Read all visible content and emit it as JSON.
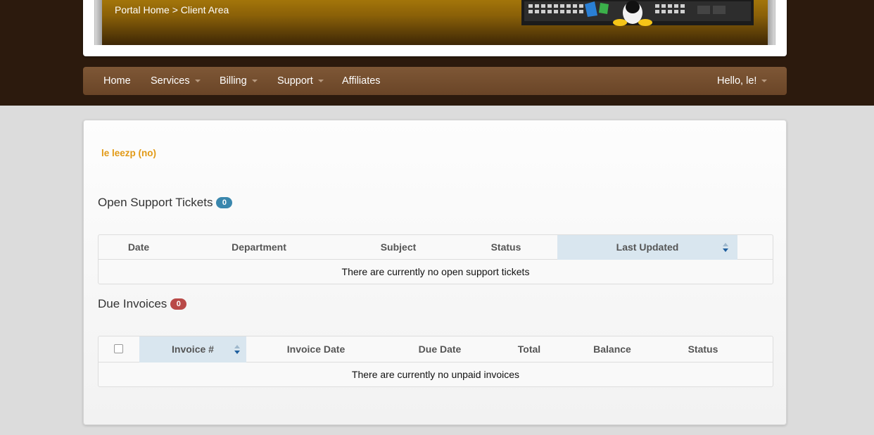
{
  "breadcrumb": {
    "home": "Portal Home",
    "separator": ">",
    "current": "Client Area"
  },
  "nav": {
    "items": [
      {
        "label": "Home",
        "dropdown": false
      },
      {
        "label": "Services",
        "dropdown": true
      },
      {
        "label": "Billing",
        "dropdown": true
      },
      {
        "label": "Support",
        "dropdown": true
      },
      {
        "label": "Affiliates",
        "dropdown": false
      }
    ],
    "user_menu": "Hello, le!"
  },
  "client": {
    "name": "le leezp (no)"
  },
  "tickets": {
    "title": "Open Support Tickets",
    "count": "0",
    "columns": [
      "Date",
      "Department",
      "Subject",
      "Status",
      "Last Updated"
    ],
    "empty_text": "There are currently no open support tickets"
  },
  "invoices": {
    "title": "Due Invoices",
    "count": "0",
    "columns": [
      "Invoice #",
      "Invoice Date",
      "Due Date",
      "Total",
      "Balance",
      "Status"
    ],
    "empty_text": "There are currently no unpaid invoices"
  },
  "colors": {
    "accent": "#e29a16",
    "navbar": "#6a4527",
    "badge_blue": "#3a87ad",
    "badge_red": "#b94a48",
    "sorted_header": "#d9e6ef"
  }
}
